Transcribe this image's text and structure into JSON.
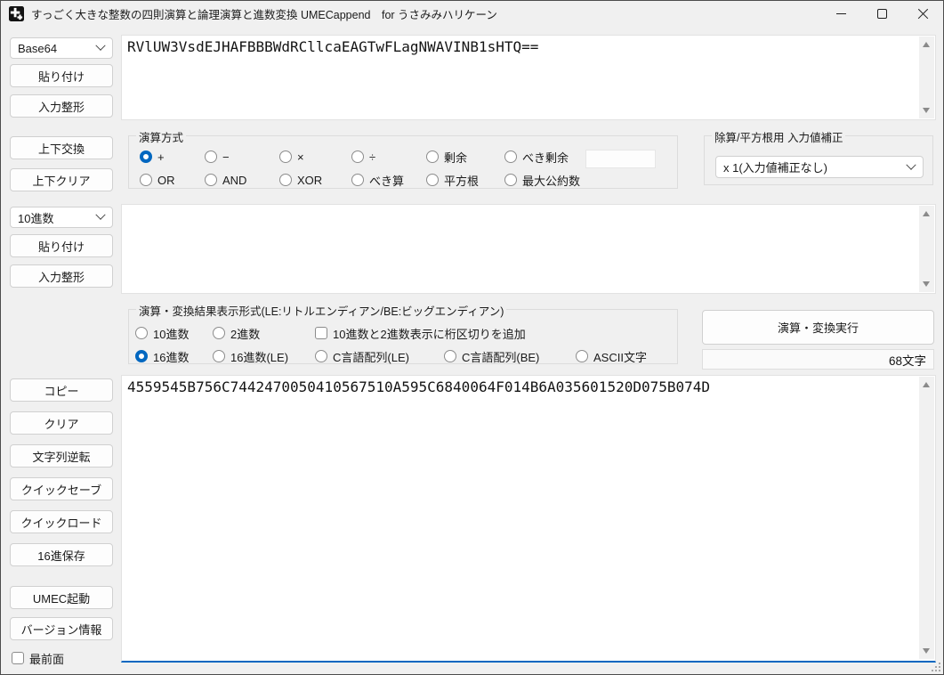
{
  "colors": {
    "accent": "#0067c0",
    "focus_underline": "#0067c0"
  },
  "window": {
    "title": "すっごく大きな整数の四則演算と論理演算と進数変換 UMECappend　for うさみみハリケーン",
    "controls": {
      "minimize": "minimize",
      "maximize": "maximize",
      "close": "close"
    }
  },
  "left_panel": {
    "base_select_top": "Base64",
    "paste_top": "貼り付け",
    "format_top": "入力整形",
    "swap_button": "上下交換",
    "clear_both_button": "上下クリア",
    "base_select_bottom": "10進数",
    "paste_bottom": "貼り付け",
    "format_bottom": "入力整形",
    "copy_button": "コピー",
    "clear_button": "クリア",
    "reverse_button": "文字列逆転",
    "quick_save_button": "クイックセーブ",
    "quick_load_button": "クイックロード",
    "hex_save_button": "16進保存",
    "umec_button": "UMEC起動",
    "version_button": "バージョン情報",
    "topmost_label": "最前面",
    "topmost_checked": false
  },
  "text_areas": {
    "base64_input": "RVlUW3VsdEJHAFBBBWdRCllcaEAGTwFLagNWAVINB1sHTQ==",
    "second_input": "",
    "result_output": "4559545B756C7442470050410567510A595C6840064F014B6A035601520D075B074D"
  },
  "operation_group": {
    "legend": "演算方式",
    "row1": [
      {
        "label": "+",
        "selected": true
      },
      {
        "label": "−",
        "selected": false
      },
      {
        "label": "×",
        "selected": false
      },
      {
        "label": "÷",
        "selected": false
      },
      {
        "label": "剰余",
        "selected": false
      },
      {
        "label": "べき剰余",
        "selected": false
      }
    ],
    "row2": [
      {
        "label": "OR",
        "selected": false
      },
      {
        "label": "AND",
        "selected": false
      },
      {
        "label": "XOR",
        "selected": false
      },
      {
        "label": "べき算",
        "selected": false
      },
      {
        "label": "平方根",
        "selected": false
      },
      {
        "label": "最大公約数",
        "selected": false
      }
    ],
    "power_mod_field_value": ""
  },
  "correction_group": {
    "legend": "除算/平方根用 入力値補正",
    "selected_value": "x 1(入力値補正なし)"
  },
  "result_format_group": {
    "legend": "演算・変換結果表示形式(LE:リトルエンディアン/BE:ビッグエンディアン)",
    "row1": [
      {
        "label": "10進数",
        "selected": false
      },
      {
        "label": "2進数",
        "selected": false
      }
    ],
    "digit_separator_checkbox": {
      "label": "10進数と2進数表示に桁区切りを追加",
      "checked": false
    },
    "row2": [
      {
        "label": "16進数",
        "selected": true
      },
      {
        "label": "16進数(LE)",
        "selected": false
      },
      {
        "label": "C言語配列(LE)",
        "selected": false
      },
      {
        "label": "C言語配列(BE)",
        "selected": false
      },
      {
        "label": "ASCII文字",
        "selected": false
      }
    ]
  },
  "execute_section": {
    "run_button": "演算・変換実行",
    "char_count": "68文字"
  }
}
